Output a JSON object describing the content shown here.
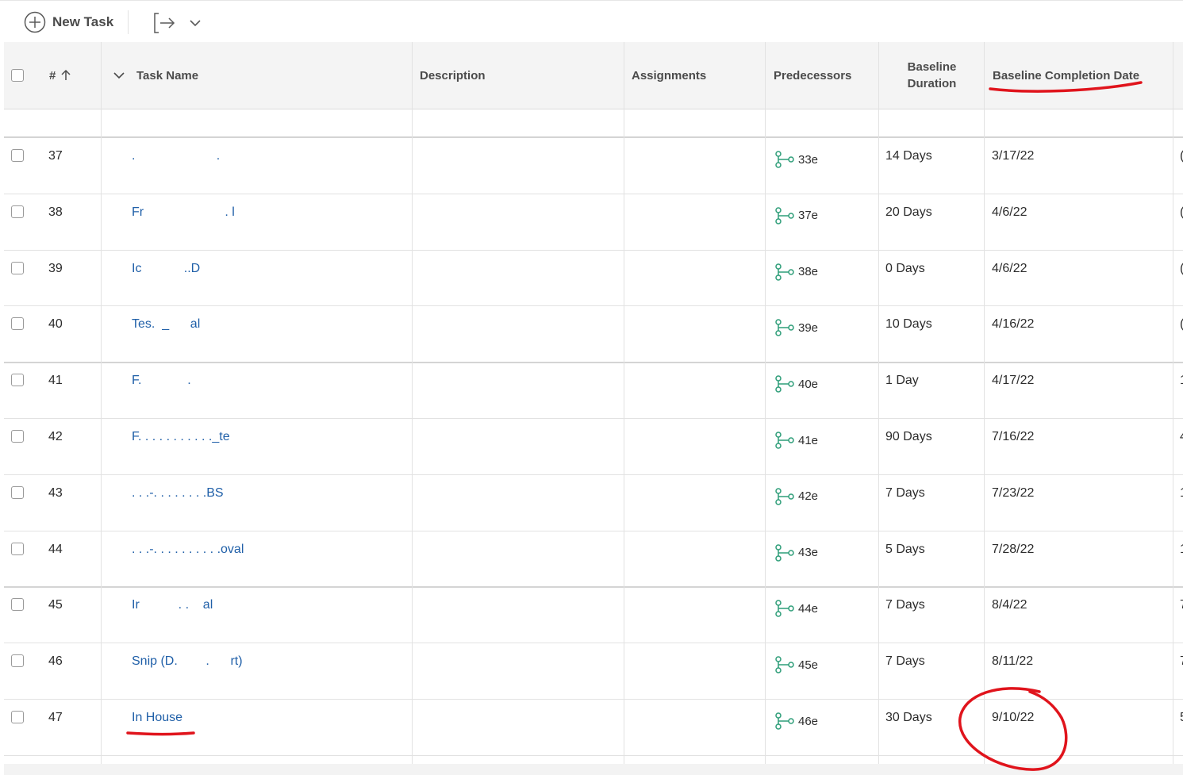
{
  "toolbar": {
    "new_task_label": "New Task",
    "export_icon": "export-icon",
    "dropdown_icon": "chevron-down-icon"
  },
  "columns": {
    "number": "#",
    "task_name": "Task Name",
    "description": "Description",
    "assignments": "Assignments",
    "predecessors": "Predecessors",
    "baseline_duration_line1": "Baseline",
    "baseline_duration_line2": "Duration",
    "baseline_completion_date": "Baseline Completion Date"
  },
  "rows": [
    {
      "num": "37",
      "name": ".                       .",
      "pred": "33e",
      "duration": "14 Days",
      "date": "3/17/22",
      "edge": "("
    },
    {
      "num": "38",
      "name": "Fr                       . l",
      "pred": "37e",
      "duration": "20 Days",
      "date": "4/6/22",
      "edge": "("
    },
    {
      "num": "39",
      "name": "Ic            ..D",
      "pred": "38e",
      "duration": "0 Days",
      "date": "4/6/22",
      "edge": "("
    },
    {
      "num": "40",
      "name": "Tes.  _      al",
      "pred": "39e",
      "duration": "10 Days",
      "date": "4/16/22",
      "edge": "("
    },
    {
      "num": "41",
      "name": "F.             .",
      "pred": "40e",
      "duration": "1 Day",
      "date": "4/17/22",
      "edge": "1"
    },
    {
      "num": "42",
      "name": "F. . . . . . . . . . ._te",
      "pred": "41e",
      "duration": "90 Days",
      "date": "7/16/22",
      "edge": "4"
    },
    {
      "num": "43",
      "name": ". . .-. . . . . . . .BS",
      "pred": "42e",
      "duration": "7 Days",
      "date": "7/23/22",
      "edge": "1"
    },
    {
      "num": "44",
      "name": ". . .-. . . . . . . . . .oval",
      "pred": "43e",
      "duration": "5 Days",
      "date": "7/28/22",
      "edge": "1"
    },
    {
      "num": "45",
      "name": "Ir           . .    al",
      "pred": "44e",
      "duration": "7 Days",
      "date": "8/4/22",
      "edge": "7"
    },
    {
      "num": "46",
      "name": "Snip (D.        .      rt)",
      "pred": "45e",
      "duration": "7 Days",
      "date": "8/11/22",
      "edge": "7"
    },
    {
      "num": "47",
      "name": "In House",
      "pred": "46e",
      "duration": "30 Days",
      "date": "9/10/22",
      "edge": "5"
    }
  ],
  "colors": {
    "link": "#1f5fa8",
    "predecessor_icon": "#2d9d78",
    "annotation": "#e0141c",
    "header_bg": "#f4f4f4"
  }
}
